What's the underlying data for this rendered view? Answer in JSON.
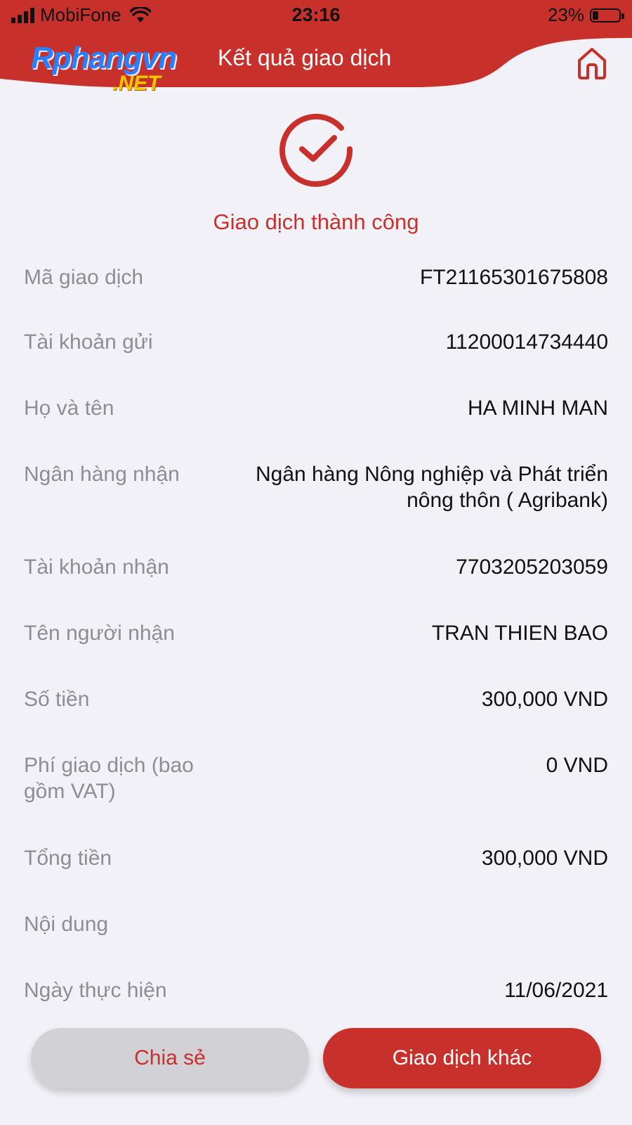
{
  "colors": {
    "accent": "#c8302c",
    "background": "#f2f1f7",
    "label": "#8e8d93",
    "value": "#111111"
  },
  "status_bar": {
    "carrier": "MobiFone",
    "time": "23:16",
    "battery_percent": "23%",
    "battery_level": 0.23,
    "icons": [
      "signal-icon",
      "wifi-icon",
      "battery-icon"
    ]
  },
  "header": {
    "logo_main": "Rphangvn",
    "logo_suffix": ".NET",
    "title": "Kết quả giao dịch",
    "home_icon": "home-icon"
  },
  "result": {
    "icon": "check-circle-icon",
    "status_text": "Giao dịch thành công"
  },
  "details": [
    {
      "label": "Mã giao dịch",
      "value": "FT21165301675808"
    },
    {
      "label": "Tài khoản gửi",
      "value": "11200014734440"
    },
    {
      "label": "Họ và tên",
      "value": "HA MINH MAN"
    },
    {
      "label": "Ngân hàng nhận",
      "value": "Ngân hàng Nông nghiệp và Phát triển nông thôn ( Agribank)"
    },
    {
      "label": "Tài khoản nhận",
      "value": "7703205203059"
    },
    {
      "label": "Tên người nhận",
      "value": "TRAN THIEN BAO"
    },
    {
      "label": "Số tiền",
      "value": "300,000 VND"
    },
    {
      "label": "Phí giao dịch (bao gồm VAT)",
      "value": "0 VND"
    },
    {
      "label": "Tổng tiền",
      "value": "300,000 VND"
    },
    {
      "label": "Nội dung",
      "value": ""
    },
    {
      "label": "Ngày thực hiện",
      "value": "11/06/2021"
    }
  ],
  "buttons": {
    "share_label": "Chia sẻ",
    "other_transaction_label": "Giao dịch khác"
  }
}
